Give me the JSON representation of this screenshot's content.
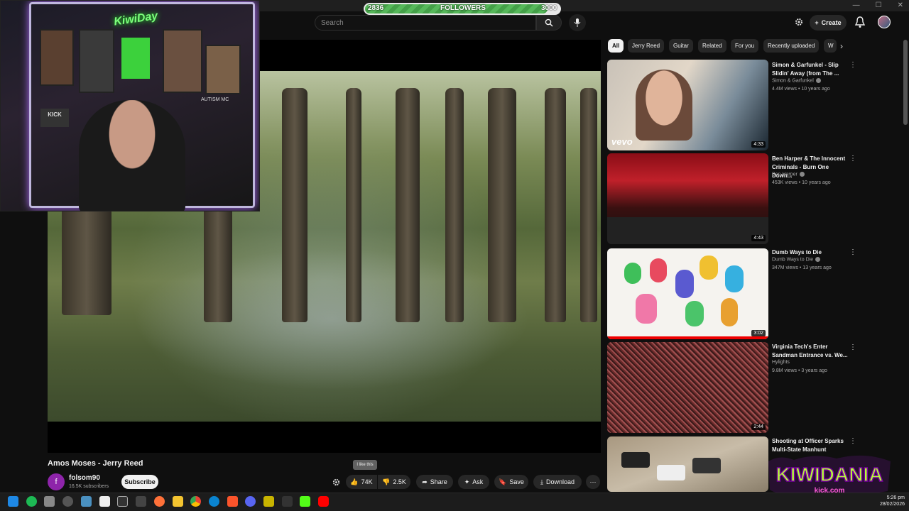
{
  "followers_goal": {
    "current": "2836",
    "label": "FOLLOWERS",
    "goal": "3000",
    "progress": 0.945
  },
  "header": {
    "search_placeholder": "Search",
    "create_label": "Create"
  },
  "chips": [
    {
      "label": "All",
      "active": true
    },
    {
      "label": "Jerry Reed"
    },
    {
      "label": "Guitar"
    },
    {
      "label": "Related"
    },
    {
      "label": "For you"
    },
    {
      "label": "Recently uploaded"
    },
    {
      "label": "W"
    }
  ],
  "video": {
    "title": "Amos Moses - Jerry Reed",
    "channel": "folsom90",
    "channel_initial": "f",
    "subscribers": "16.5K subscribers",
    "subscribe_label": "Subscribe",
    "likes": "74K",
    "dislikes": "2.5K",
    "tooltip": "I like this",
    "share_label": "Share",
    "ask_label": "Ask",
    "save_label": "Save",
    "download_label": "Download"
  },
  "webcam": {
    "sign_text": "KiwiDay",
    "kick_label": "KICK",
    "poster_text": "AUTISM MC"
  },
  "recommendations": [
    {
      "title": "Simon & Garfunkel - Slip Slidin' Away (from The ...",
      "channel": "Simon & Garfunkel",
      "meta": "4.4M views • 10 years ago",
      "duration": "4:33",
      "watermark": "vevo"
    },
    {
      "title": "Ben Harper & The Innocent Criminals - Burn One Down...",
      "channel": "Ben Harper",
      "meta": "453K views • 10 years ago",
      "duration": "4:43"
    },
    {
      "title": "Dumb Ways to Die",
      "channel": "Dumb Ways to Die",
      "meta": "347M views • 13 years ago",
      "duration": "3:02"
    },
    {
      "title": "Virginia Tech's Enter Sandman Entrance vs. We...",
      "channel": "Hylights",
      "meta": "9.8M views • 3 years ago",
      "duration": "2:44"
    },
    {
      "title": "Shooting at Officer Sparks Multi-State Manhunt",
      "channel": "",
      "meta": "",
      "duration": ""
    }
  ],
  "logo": {
    "text": "KIWIDANIA",
    "sub": "kick.com"
  },
  "taskbar": {
    "time": "5:26 pm",
    "date": "28/02/2026"
  },
  "colors": {
    "accent_green": "#56b85a",
    "bg": "#0f0f0f",
    "chip_bg": "#272727"
  }
}
